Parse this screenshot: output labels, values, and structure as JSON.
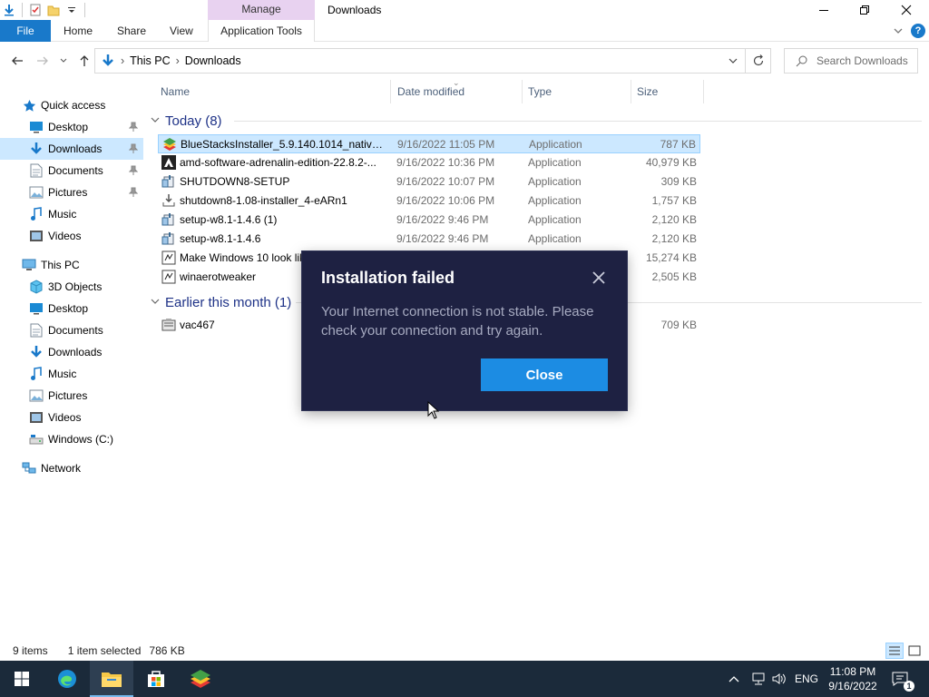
{
  "window": {
    "title": "Downloads",
    "context_tab": "Manage"
  },
  "ribbon": {
    "tabs": [
      "File",
      "Home",
      "Share",
      "View",
      "Application Tools"
    ]
  },
  "address": {
    "crumbs": [
      "This PC",
      "Downloads"
    ],
    "search_placeholder": "Search Downloads"
  },
  "nav": {
    "quick_access": "Quick access",
    "quick_items": [
      {
        "label": "Desktop",
        "icon": "desktop-icon"
      },
      {
        "label": "Downloads",
        "icon": "downloads-icon"
      },
      {
        "label": "Documents",
        "icon": "documents-icon"
      },
      {
        "label": "Pictures",
        "icon": "pictures-icon"
      },
      {
        "label": "Music",
        "icon": "music-icon"
      },
      {
        "label": "Videos",
        "icon": "videos-icon"
      }
    ],
    "this_pc": "This PC",
    "pc_items": [
      {
        "label": "3D Objects",
        "icon": "3d-objects-icon"
      },
      {
        "label": "Desktop",
        "icon": "desktop-icon"
      },
      {
        "label": "Documents",
        "icon": "documents-icon"
      },
      {
        "label": "Downloads",
        "icon": "downloads-icon"
      },
      {
        "label": "Music",
        "icon": "music-icon"
      },
      {
        "label": "Pictures",
        "icon": "pictures-icon"
      },
      {
        "label": "Videos",
        "icon": "videos-icon"
      },
      {
        "label": "Windows (C:)",
        "icon": "drive-icon"
      }
    ],
    "network": "Network"
  },
  "columns": {
    "name": "Name",
    "date": "Date modified",
    "type": "Type",
    "size": "Size"
  },
  "groups": {
    "today": "Today (8)",
    "earlier": "Earlier this month (1)"
  },
  "files_today": [
    {
      "name": "BlueStacksInstaller_5.9.140.1014_native_4...",
      "date": "9/16/2022 11:05 PM",
      "type": "Application",
      "size": "787 KB"
    },
    {
      "name": "amd-software-adrenalin-edition-22.8.2-...",
      "date": "9/16/2022 10:36 PM",
      "type": "Application",
      "size": "40,979 KB"
    },
    {
      "name": "SHUTDOWN8-SETUP",
      "date": "9/16/2022 10:07 PM",
      "type": "Application",
      "size": "309 KB"
    },
    {
      "name": "shutdown8-1.08-installer_4-eARn1",
      "date": "9/16/2022 10:06 PM",
      "type": "Application",
      "size": "1,757 KB"
    },
    {
      "name": "setup-w8.1-1.4.6 (1)",
      "date": "9/16/2022 9:46 PM",
      "type": "Application",
      "size": "2,120 KB"
    },
    {
      "name": "setup-w8.1-1.4.6",
      "date": "9/16/2022 9:46 PM",
      "type": "Application",
      "size": "2,120 KB"
    },
    {
      "name": "Make Windows 10 look lik",
      "date": "",
      "type": "",
      "size": "15,274 KB"
    },
    {
      "name": "winaerotweaker",
      "date": "",
      "type": "",
      "size": "2,505 KB"
    }
  ],
  "files_earlier": [
    {
      "name": "vac467",
      "date": "",
      "type": "",
      "size": "709 KB"
    }
  ],
  "status": {
    "items": "9 items",
    "selected": "1 item selected",
    "sel_size": "786 KB"
  },
  "dialog": {
    "title": "Installation failed",
    "message": "Your Internet connection is not stable. Please check your connection and try again.",
    "button": "Close"
  },
  "taskbar": {
    "lang": "ENG",
    "time": "11:08 PM",
    "date": "9/16/2022",
    "notifications": "1"
  },
  "colors": {
    "accent": "#1979ca",
    "dialog_bg": "#1e2142",
    "dialog_button": "#1c8ce3",
    "selection": "#cce8ff",
    "taskbar": "#1b2a3a"
  }
}
